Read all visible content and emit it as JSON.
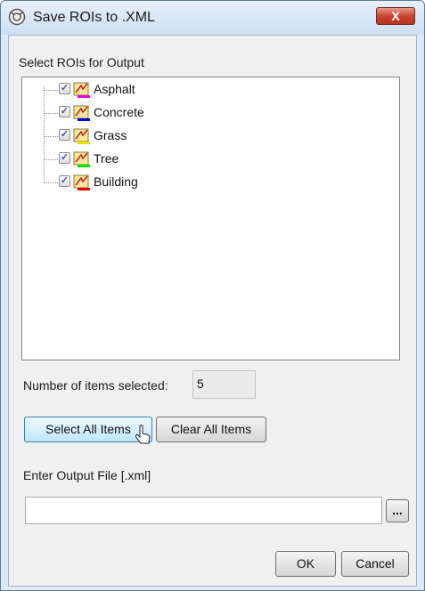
{
  "window": {
    "title": "Save ROIs to .XML",
    "close_label": "X"
  },
  "roi_panel": {
    "label": "Select ROIs for Output",
    "items": [
      {
        "label": "Asphalt",
        "checked": true,
        "color": "#e600e6"
      },
      {
        "label": "Concrete",
        "checked": true,
        "color": "#0000e6"
      },
      {
        "label": "Grass",
        "checked": true,
        "color": "#e6e600"
      },
      {
        "label": "Tree",
        "checked": true,
        "color": "#00e600"
      },
      {
        "label": "Building",
        "checked": true,
        "color": "#e60000"
      }
    ]
  },
  "count": {
    "label": "Number of items selected:",
    "value": "5"
  },
  "buttons": {
    "select_all": "Select All Items",
    "clear_all": "Clear All Items",
    "browse": "...",
    "ok": "OK",
    "cancel": "Cancel"
  },
  "output": {
    "label": "Enter Output File [.xml]",
    "value": ""
  },
  "check_glyph": "✓"
}
